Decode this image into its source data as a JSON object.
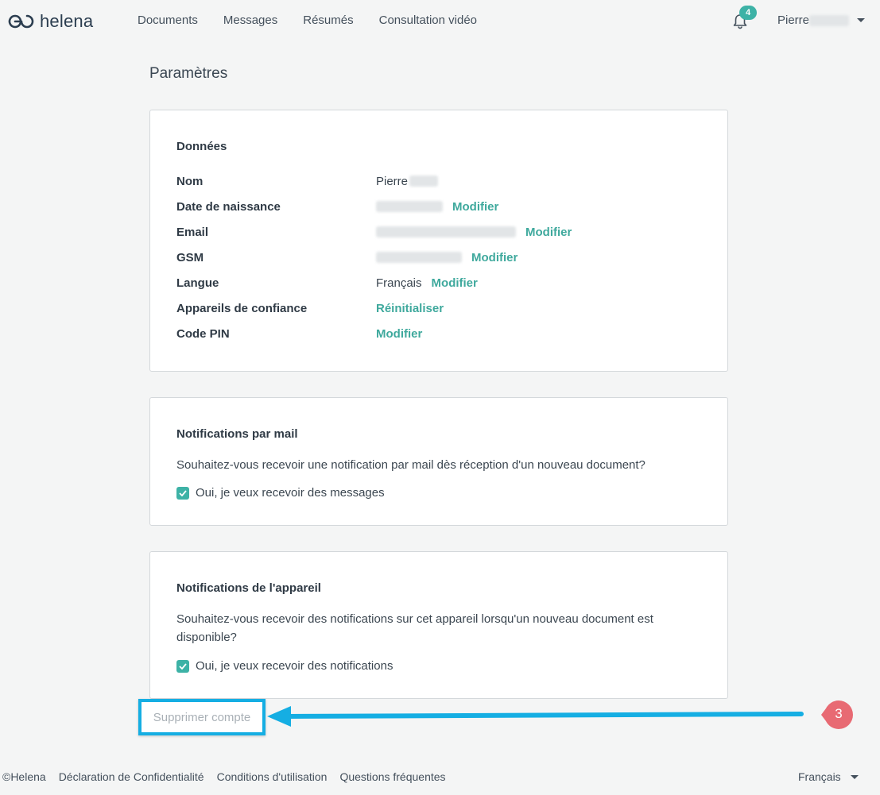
{
  "brand": {
    "name": "helena",
    "accent": "#3db2a6"
  },
  "nav": [
    "Documents",
    "Messages",
    "Résumés",
    "Consultation vidéo"
  ],
  "notifications": {
    "count": "4"
  },
  "user": {
    "first_name": "Pierre"
  },
  "page_title": "Paramètres",
  "data_card": {
    "title": "Données",
    "rows": [
      {
        "label": "Nom",
        "value": "Pierre",
        "action": ""
      },
      {
        "label": "Date de naissance",
        "value": "",
        "action": "Modifier"
      },
      {
        "label": "Email",
        "value": "",
        "action": "Modifier"
      },
      {
        "label": "GSM",
        "value": "",
        "action": "Modifier"
      },
      {
        "label": "Langue",
        "value": "Français",
        "action": "Modifier"
      },
      {
        "label": "Appareils de confiance",
        "value": "",
        "action": "Réinitialiser"
      },
      {
        "label": "Code PIN",
        "value": "",
        "action": "Modifier"
      }
    ]
  },
  "mail_card": {
    "title": "Notifications par mail",
    "question": "Souhaitez-vous recevoir une notification par mail dès réception d'un nouveau document?",
    "checkbox_label": "Oui, je veux recevoir des messages",
    "checked": true
  },
  "device_card": {
    "title": "Notifications de l'appareil",
    "question": "Souhaitez-vous recevoir des notifications sur cet appareil lorsqu'un nouveau document est disponible?",
    "checkbox_label": "Oui, je veux recevoir des notifications",
    "checked": true
  },
  "delete_account": "Supprimer compte",
  "annotation": {
    "step": "3",
    "highlight_color": "#15aee3",
    "badge_color": "#e86a73"
  },
  "footer": {
    "links": [
      "©Helena",
      "Déclaration de Confidentialité",
      "Conditions d'utilisation",
      "Questions fréquentes"
    ],
    "language": "Français"
  }
}
